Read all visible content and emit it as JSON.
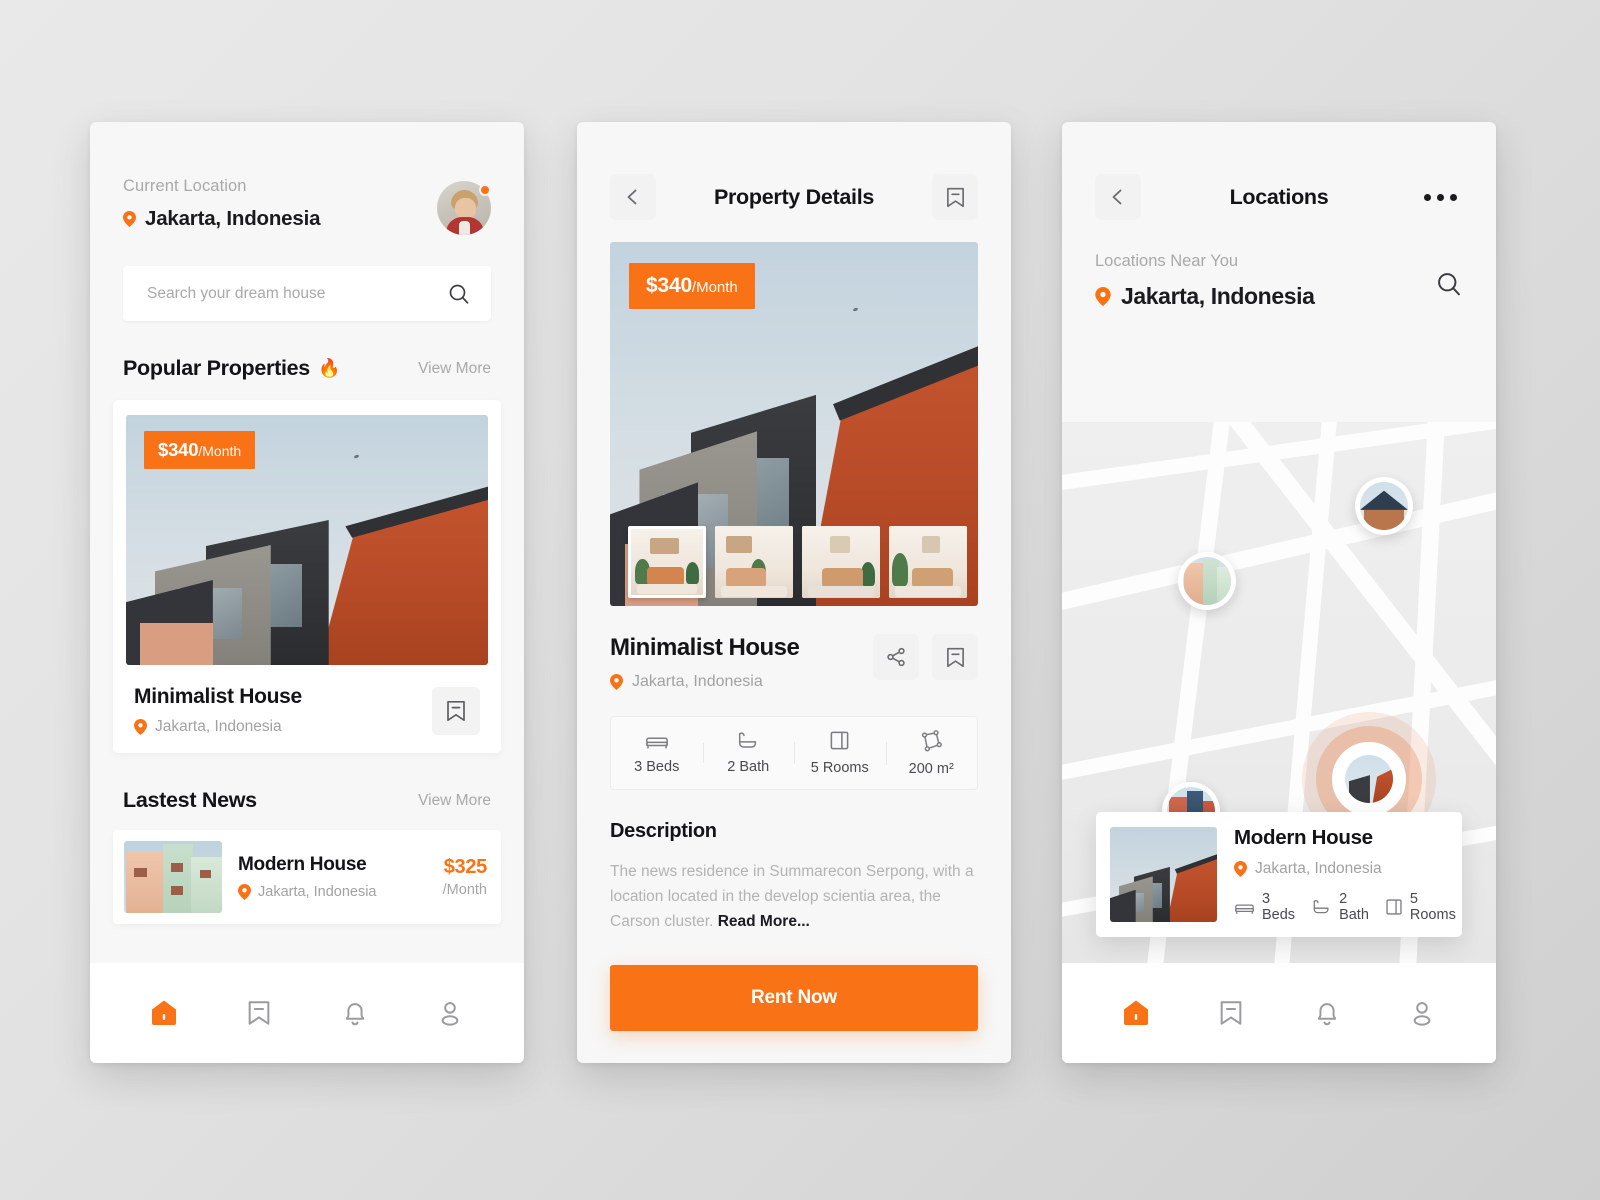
{
  "accent": "#f97316",
  "screens": {
    "home": {
      "location_label": "Current Location",
      "location_city": "Jakarta, Indonesia",
      "search_placeholder": "Search your dream house",
      "search_value": "",
      "popular": {
        "title": "Popular Properties",
        "emoji": "🔥",
        "view_more": "View More",
        "card": {
          "price_amount": "$340",
          "price_period": "/Month",
          "name": "Minimalist House",
          "location": "Jakarta, Indonesia"
        }
      },
      "news": {
        "title": "Lastest News",
        "view_more": "View More",
        "item": {
          "name": "Modern House",
          "location": "Jakarta, Indonesia",
          "price_amount": "$325",
          "price_period": "/Month"
        }
      },
      "nav": [
        {
          "name": "home-icon",
          "active": true
        },
        {
          "name": "bookmark-icon",
          "active": false
        },
        {
          "name": "bell-icon",
          "active": false
        },
        {
          "name": "user-icon",
          "active": false
        }
      ]
    },
    "details": {
      "title": "Property Details",
      "back_icon": "chevron-left-icon",
      "bookmark_icon": "bookmark-icon",
      "price_amount": "$340",
      "price_period": "/Month",
      "name": "Minimalist House",
      "location": "Jakarta, Indonesia",
      "share_icon": "share-icon",
      "specs": [
        {
          "icon": "bed-icon",
          "label": "3 Beds"
        },
        {
          "icon": "bath-icon",
          "label": "2 Bath"
        },
        {
          "icon": "room-icon",
          "label": "5 Rooms"
        },
        {
          "icon": "area-icon",
          "label": "200 m²"
        }
      ],
      "description_heading": "Description",
      "description_text": "The news residence in Summarecon Serpong, with a location located in the develop scientia area, the Carson cluster.",
      "read_more": "Read More...",
      "cta": "Rent Now",
      "thumbnails": [
        "living-room-1",
        "living-room-2",
        "living-room-3",
        "living-room-4"
      ]
    },
    "locations": {
      "title": "Locations",
      "back_icon": "chevron-left-icon",
      "more_icon": "more-horizontal-icon",
      "near_label": "Locations Near You",
      "near_city": "Jakarta, Indonesia",
      "search_icon": "search-icon",
      "markers": [
        {
          "name": "marker-brick-house",
          "selected": false
        },
        {
          "name": "marker-apartment",
          "selected": false
        },
        {
          "name": "marker-blue-building",
          "selected": false
        },
        {
          "name": "marker-modern-house",
          "selected": true
        }
      ],
      "card": {
        "name": "Modern House",
        "location": "Jakarta, Indonesia",
        "specs": [
          {
            "icon": "bed-icon",
            "label": "3 Beds"
          },
          {
            "icon": "bath-icon",
            "label": "2 Bath"
          },
          {
            "icon": "room-icon",
            "label": "5 Rooms"
          }
        ]
      },
      "nav": [
        {
          "name": "home-icon",
          "active": true
        },
        {
          "name": "bookmark-icon",
          "active": false
        },
        {
          "name": "bell-icon",
          "active": false
        },
        {
          "name": "user-icon",
          "active": false
        }
      ]
    }
  }
}
